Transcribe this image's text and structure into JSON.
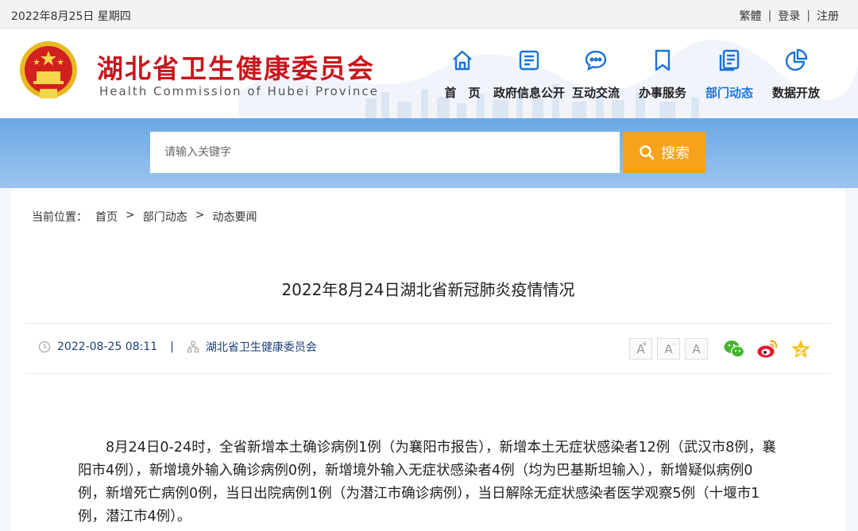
{
  "topbar": {
    "date": "2022年8月25日 星期四",
    "links": [
      "繁體",
      "登录",
      "注册"
    ]
  },
  "header": {
    "title": "湖北省卫生健康委员会",
    "subtitle": "Health Commission of Hubei Province"
  },
  "nav": {
    "items": [
      {
        "label": "首　页",
        "icon": "home-icon"
      },
      {
        "label": "政府信息公开",
        "icon": "document-icon"
      },
      {
        "label": "互动交流",
        "icon": "chat-icon"
      },
      {
        "label": "办事服务",
        "icon": "bookmark-icon"
      },
      {
        "label": "部门动态",
        "icon": "news-icon"
      },
      {
        "label": "数据开放",
        "icon": "pie-chart-icon"
      }
    ],
    "active_index": 4
  },
  "search": {
    "placeholder": "请输入关键字",
    "button_label": "搜索"
  },
  "breadcrumb": {
    "prefix": "当前位置：",
    "items": [
      "首页",
      "部门动态",
      "动态要闻"
    ],
    "separator": ">"
  },
  "article": {
    "title": "2022年8月24日湖北省新冠肺炎疫情情况",
    "datetime": "2022-08-25 08:11",
    "source": "湖北省卫生健康委员会",
    "body": "8月24日0-24时，全省新增本土确诊病例1例（为襄阳市报告），新增本土无症状感染者12例（武汉市8例，襄阳市4例），新增境外输入确诊病例0例，新增境外输入无症状感染者4例（均为巴基斯坦输入），新增疑似病例0例，新增死亡病例0例，当日出院病例1例（为潜江市确诊病例），当日解除无症状感染者医学观察5例（十堰市1例，潜江市4例）。"
  },
  "font_tools": {
    "large": "A",
    "large_sup": "+",
    "medium": "A",
    "medium_sup": "-",
    "default": "A"
  },
  "colors": {
    "brand_red": "#c8161d",
    "nav_active": "#1a73d9",
    "search_button": "#f7a21b",
    "meta_text": "#1c3f7a"
  }
}
